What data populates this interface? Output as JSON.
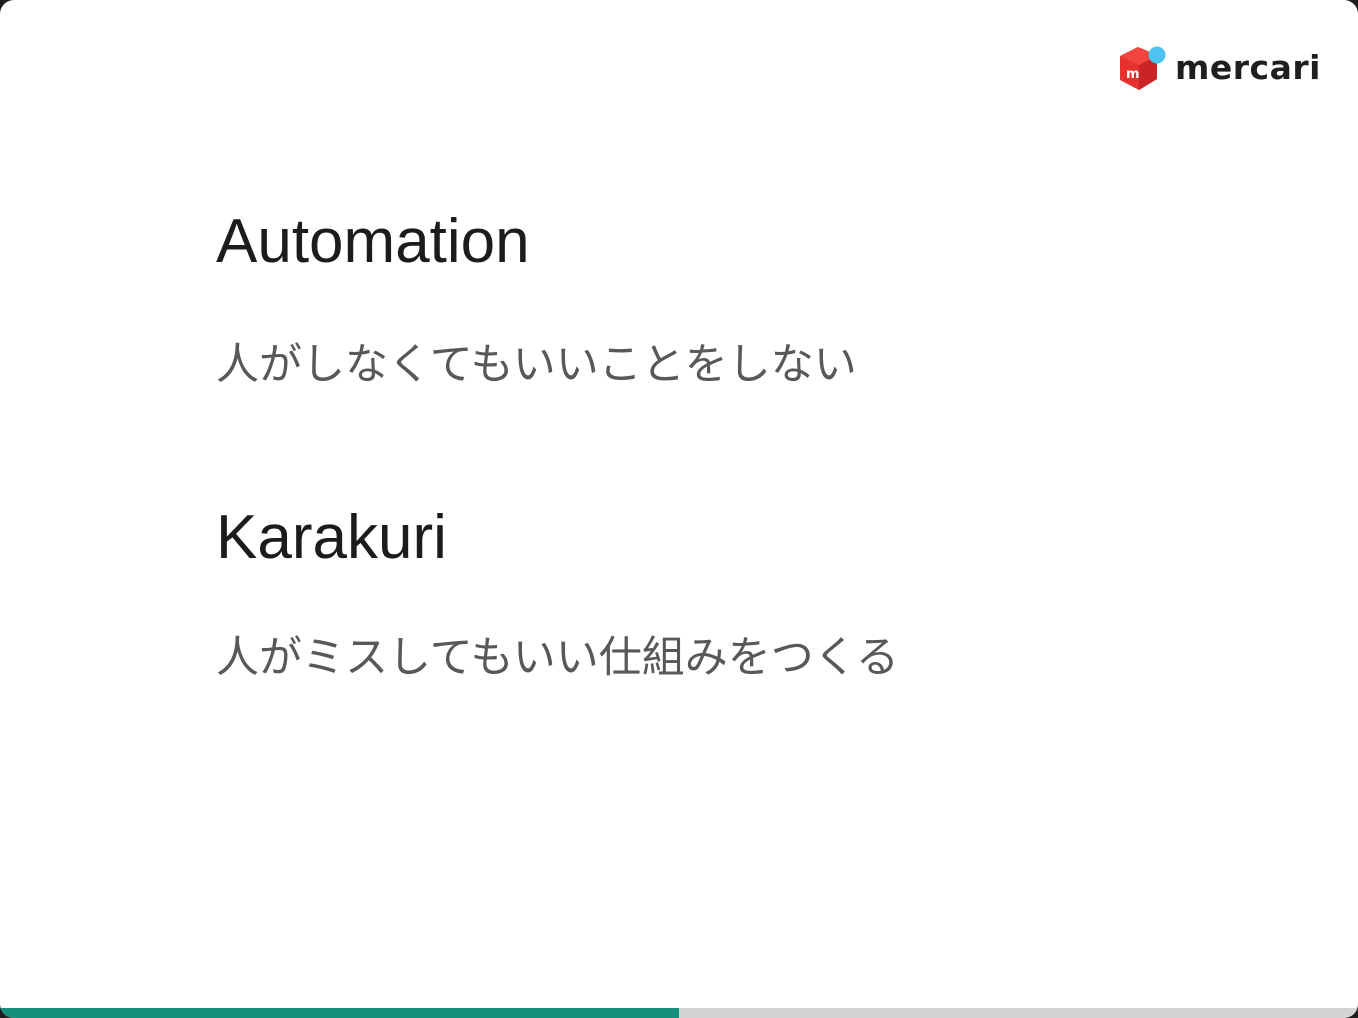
{
  "logo": {
    "text": "mercari",
    "icon": "mercari-box-icon",
    "badge_letter": "m",
    "colors": {
      "red": "#e8302e",
      "red_dark": "#b31f20",
      "blue": "#4dc3f2"
    }
  },
  "sections": [
    {
      "heading": "Automation",
      "text": "人がしなくてもいいことをしない"
    },
    {
      "heading": "Karakuri",
      "text": "人がミスしてもいい仕組みをつくる"
    }
  ],
  "progress": {
    "fraction": 0.5,
    "fill_color": "#16907a",
    "track_color": "#d4d4d4"
  }
}
